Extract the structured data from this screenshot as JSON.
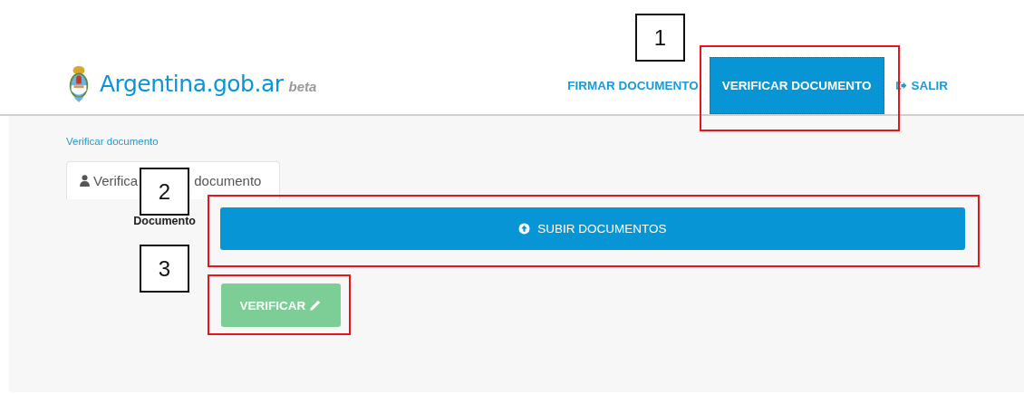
{
  "header": {
    "brand": "Argentina.gob.ar",
    "badge": "beta",
    "nav": [
      {
        "label": "FIRMAR DOCUMENTO",
        "selected": false,
        "kind": "link"
      },
      {
        "label": "VERIFICAR DOCUMENTO",
        "selected": true,
        "kind": "link"
      },
      {
        "label": "SALIR",
        "selected": false,
        "kind": "exit"
      }
    ]
  },
  "breadcrumb": "Verificar documento",
  "tab": {
    "label_parts": [
      "Verifica",
      "documento"
    ]
  },
  "form": {
    "label": "Documento",
    "upload_button": "SUBIR DOCUMENTOS",
    "verify_button": {
      "label": "VERIFICAR",
      "disabled": true
    }
  },
  "annotations": [
    {
      "number": "1"
    },
    {
      "number": "2"
    },
    {
      "number": "3"
    }
  ]
}
